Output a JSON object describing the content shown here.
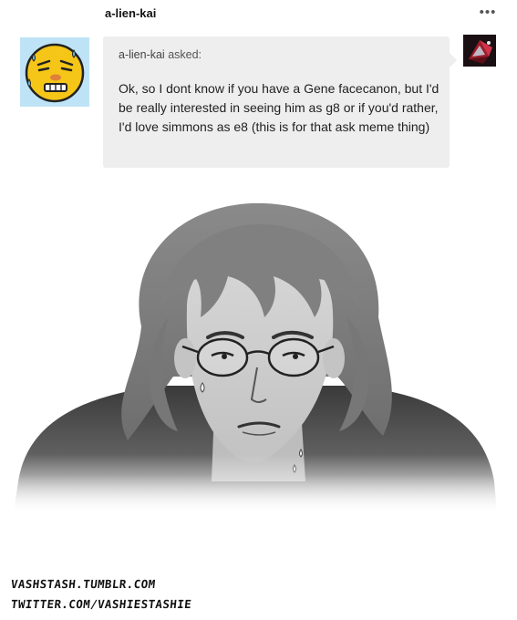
{
  "post": {
    "blog_name": "a-lien-kai",
    "more_label": "•••"
  },
  "ask": {
    "asker_name": "a-lien-kai",
    "asked_label": " asked:",
    "question": "Ok, so I dont know if you have a Gene facecanon, but I'd be really interested in seeing him as g8 or if you'd rather, I'd love simmons as e8 (this is for that ask meme thing)"
  },
  "credits": {
    "line1": "VASHSTASH.TUMBLR.COM",
    "line2": "TWITTER.COM/VASHIESTASHIE"
  },
  "colors": {
    "ask_bubble": "#eeeeee",
    "asker_avatar_bg": "#bfe3f6",
    "emoji_face": "#f5c518"
  },
  "icons": {
    "more": "ellipsis-icon",
    "asker_avatar": "grimace-emoji-avatar",
    "answer_avatar": "red-cube-avatar"
  }
}
